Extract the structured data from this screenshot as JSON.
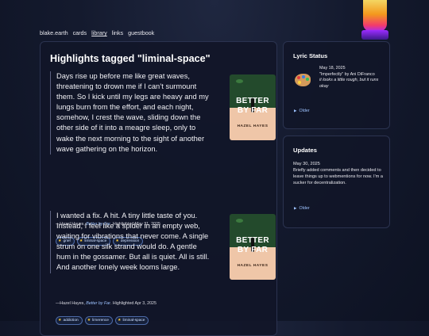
{
  "nav": {
    "items": [
      {
        "label": "blake.earth"
      },
      {
        "label": "cards"
      },
      {
        "label": "library",
        "active": true
      },
      {
        "label": "links"
      },
      {
        "label": "guestbook"
      }
    ]
  },
  "main": {
    "title": "Highlights tagged \"liminal-space\"",
    "highlights": [
      {
        "text": "Days rise up before me like great waves, threatening to drown me if I can’t surmount them. So I kick until my legs are heavy and my lungs burn from the effort, and each night, somehow, I crest the wave, sliding down the other side of it into a meagre sleep, only to wake the next morning to the sight of another wave gathering on the horizon.",
        "author": "—Hazel Hayes,",
        "book": "Better by Far",
        "date": ". Highlighted May 31, 2025",
        "tags": [
          "grief",
          "liminal-space",
          "depression"
        ],
        "cover": {
          "line1": "BETTER",
          "line2": "BY FAR",
          "author": "HAZEL HAYES"
        }
      },
      {
        "text": "I wanted a fix. A hit. A tiny little taste of you. Instead, I feel like a spider in an empty web, waiting for vibrations that never come. A single strum on one silk strand would do. A gentle hum in the gossamer. But all is quiet. All is still. And another lonely week looms large.",
        "author": "—Hazel Hayes,",
        "book": "Better by Far",
        "date": ". Highlighted Apr 3, 2025",
        "tags": [
          "addiction",
          "limerence",
          "liminal-space"
        ],
        "cover": {
          "line1": "BETTER",
          "line2": "BY FAR",
          "author": "HAZEL HAYES"
        }
      }
    ]
  },
  "lyric_status": {
    "title": "Lyric Status",
    "date": "May 18, 2025",
    "song": "\"Imperfectly\" by Ani DiFranco",
    "lyric": "it looks a little rough, but it runs okay",
    "older": "Older",
    "icon": "palette-icon"
  },
  "updates": {
    "title": "Updates",
    "date": "May 30, 2025",
    "text": "Briefly added comments and then decided to leave things up to webmentions for now. I'm a sucker for decentralization.",
    "older": "Older"
  },
  "colors": {
    "accent": "#9ec3ff",
    "tag_border": "#4c6aa8",
    "star": "#ffcc33"
  }
}
